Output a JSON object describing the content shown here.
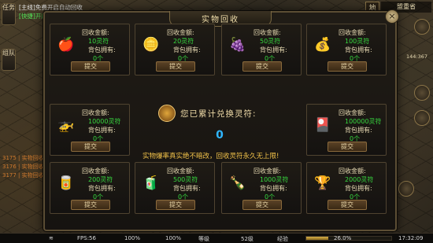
{
  "chat": {
    "line1": "[主线]免费开启自动回收",
    "line2": "[快捷]开启自动回收实物",
    "line3": "3175 | 实物回收奖励",
    "line4": "3176 | 实物回收奖励",
    "line5": "3177 | 实物回收奖励"
  },
  "side_buttons": {
    "task": "任务",
    "team": "组队"
  },
  "top_right": {
    "map_badge": "地",
    "map_name": "盟重省",
    "coords": "144:367"
  },
  "dialog": {
    "title": "实物回收",
    "close": "×",
    "center": {
      "title": "您已累计兑换灵符:",
      "count": "0",
      "note": "实物爆率真实绝不暗改，回收灵符永久无上限!"
    },
    "labels": {
      "amount": "回收金额:",
      "bag": "背包拥有:",
      "submit": "提交"
    },
    "items": [
      {
        "icon": "apple-icon",
        "glyph": "🍎",
        "amount": "10灵符",
        "owned": "0个"
      },
      {
        "icon": "gold-ingot-icon",
        "glyph": "🪙",
        "amount": "20灵符",
        "owned": "0个"
      },
      {
        "icon": "grapes-icon",
        "glyph": "🍇",
        "amount": "50灵符",
        "owned": "0个"
      },
      {
        "icon": "coin-pile-icon",
        "glyph": "💰",
        "amount": "100灵符",
        "owned": "0个"
      },
      {
        "icon": "helicopter-icon",
        "glyph": "🚁",
        "amount": "10000灵符",
        "owned": "0个"
      },
      {
        "icon": "card-pack-icon",
        "glyph": "🎴",
        "amount": "100000灵符",
        "owned": "0个"
      },
      {
        "icon": "soda-can-icon",
        "glyph": "🥫",
        "amount": "200灵符",
        "owned": "0个"
      },
      {
        "icon": "red-can-icon",
        "glyph": "🧃",
        "amount": "500灵符",
        "owned": "0个"
      },
      {
        "icon": "bottle-icon",
        "glyph": "🍾",
        "amount": "1000灵符",
        "owned": "0个"
      },
      {
        "icon": "trophy-icon",
        "glyph": "🏆",
        "amount": "2000灵符",
        "owned": "0个"
      }
    ]
  },
  "bottom_bar": {
    "fps": "FPS:56",
    "battery1": "100%",
    "battery2": "100%",
    "level_label": "等级",
    "level": "52级",
    "exp_label": "经验",
    "exp_percent": "26.0%",
    "exp_fraction": 0.26,
    "time": "17:32:09"
  },
  "colors": {
    "accent": "#37d93f",
    "gold": "#f3c34a",
    "count": "#2fb6ff"
  }
}
